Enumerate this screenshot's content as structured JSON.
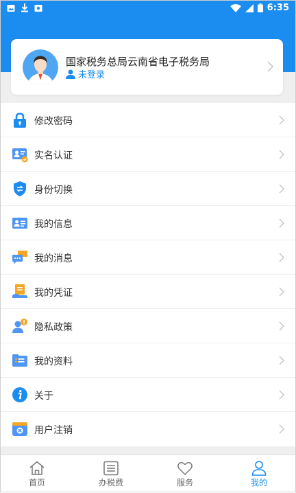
{
  "status_bar": {
    "time": "6:35"
  },
  "profile": {
    "org_name": "国家税务总局云南省电子税务局",
    "login_status": "未登录"
  },
  "menu": [
    {
      "label": "修改密码",
      "icon": "lock-icon"
    },
    {
      "label": "实名认证",
      "icon": "id-card-icon"
    },
    {
      "label": "身份切换",
      "icon": "shield-switch-icon"
    },
    {
      "label": "我的信息",
      "icon": "info-card-icon"
    },
    {
      "label": "我的消息",
      "icon": "message-icon"
    },
    {
      "label": "我的凭证",
      "icon": "voucher-icon"
    },
    {
      "label": "隐私政策",
      "icon": "privacy-icon"
    },
    {
      "label": "我的资料",
      "icon": "folder-icon"
    },
    {
      "label": "关于",
      "icon": "about-icon"
    },
    {
      "label": "用户注销",
      "icon": "deregister-icon"
    }
  ],
  "bottom_nav": [
    {
      "label": "首页",
      "icon": "home-icon",
      "active": false
    },
    {
      "label": "办税费",
      "icon": "list-icon",
      "active": false
    },
    {
      "label": "服务",
      "icon": "heart-icon",
      "active": false
    },
    {
      "label": "我的",
      "icon": "user-icon",
      "active": true
    }
  ],
  "colors": {
    "primary": "#1b8cf0",
    "background": "#efefef",
    "text": "#333333"
  }
}
